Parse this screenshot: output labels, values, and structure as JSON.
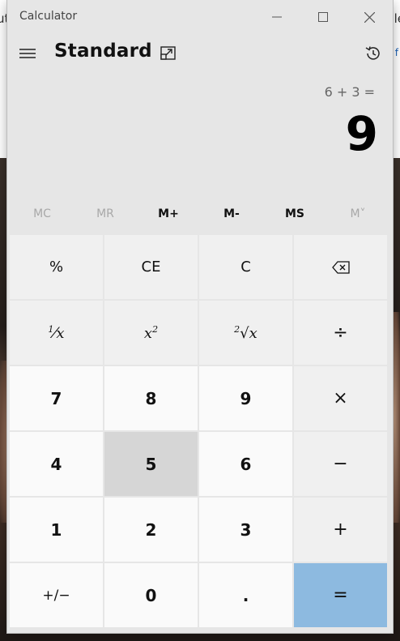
{
  "background": {
    "left_edge_text": "ut",
    "right_edge_text": "le",
    "right_edge_small": "f"
  },
  "window": {
    "title": "Calculator",
    "controls": {
      "minimize_icon": "minimize-icon",
      "maximize_icon": "maximize-icon",
      "close_icon": "close-icon"
    }
  },
  "header": {
    "menu_icon": "hamburger-menu-icon",
    "mode": "Standard",
    "keep_on_top_icon": "keep-on-top-icon",
    "history_icon": "history-icon"
  },
  "display": {
    "expression": "6 + 3 =",
    "result": "9"
  },
  "memory": {
    "mc": "MC",
    "mr": "MR",
    "m_plus": "M+",
    "m_minus": "M-",
    "ms": "MS",
    "m_list": "M˅"
  },
  "keys": {
    "percent": "%",
    "ce": "CE",
    "clear": "C",
    "backspace_icon": "backspace-icon",
    "reciprocal_num": "1",
    "reciprocal_den": "x",
    "square_base": "x",
    "square_exp": "2",
    "sqrt_index": "2",
    "sqrt_var": "x",
    "divide": "÷",
    "seven": "7",
    "eight": "8",
    "nine": "9",
    "multiply": "×",
    "four": "4",
    "five": "5",
    "six": "6",
    "minus": "−",
    "one": "1",
    "two": "2",
    "three": "3",
    "plus": "+",
    "negate": "+/−",
    "zero": "0",
    "decimal": ".",
    "equals": "="
  },
  "colors": {
    "equals_key": "#8dbae0",
    "pressed_key": "#d6d6d6"
  }
}
